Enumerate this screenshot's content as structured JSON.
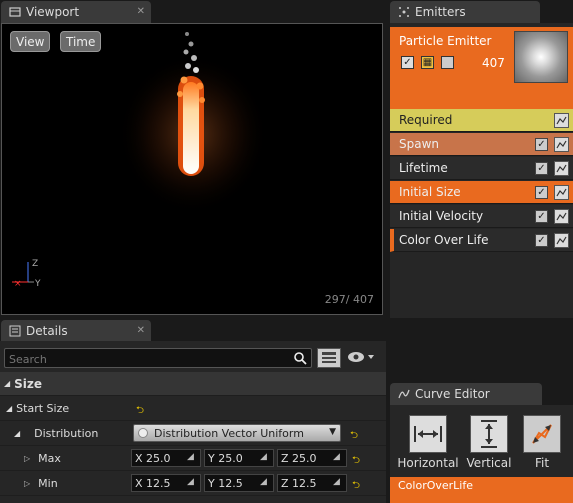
{
  "viewport": {
    "tab_label": "Viewport",
    "view_button": "View",
    "time_button": "Time",
    "particle_count": "297/ 407",
    "axis_z": "Z",
    "axis_y": "Y"
  },
  "emitters": {
    "tab_label": "Emitters",
    "emitter_name": "Particle Emitter",
    "emitter_count": "407",
    "modules": [
      {
        "label": "Required",
        "state": "required"
      },
      {
        "label": "Spawn",
        "state": "highlight"
      },
      {
        "label": "Lifetime",
        "state": "normal"
      },
      {
        "label": "Initial Size",
        "state": "selected"
      },
      {
        "label": "Initial Velocity",
        "state": "normal"
      },
      {
        "label": "Color Over Life",
        "state": "marked"
      }
    ]
  },
  "details": {
    "tab_label": "Details",
    "search_placeholder": "Search",
    "section_title": "Size",
    "start_size_label": "Start Size",
    "distribution_label": "Distribution",
    "distribution_value": "Distribution Vector Uniform",
    "max_label": "Max",
    "min_label": "Min",
    "max": {
      "x_label": "X",
      "x": "25.0",
      "y_label": "Y",
      "y": "25.0",
      "z_label": "Z",
      "z": "25.0"
    },
    "min": {
      "x_label": "X",
      "x": "12.5",
      "y_label": "Y",
      "y": "12.5",
      "z_label": "Z",
      "z": "12.5"
    }
  },
  "curve_editor": {
    "tab_label": "Curve Editor",
    "horizontal_label": "Horizontal",
    "vertical_label": "Vertical",
    "fit_label": "Fit",
    "curve_item": "ColorOverLife"
  },
  "colors": {
    "accent": "#e96a1f",
    "required": "#d6cc5a",
    "panel": "#262626"
  }
}
